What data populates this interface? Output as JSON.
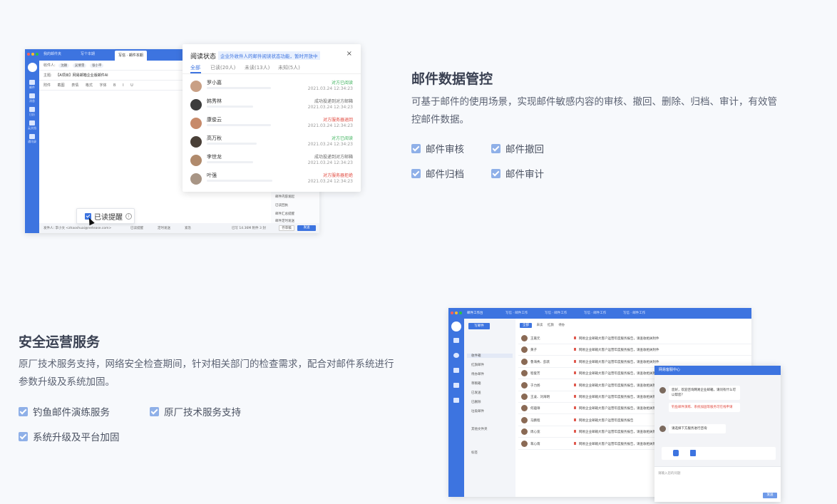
{
  "section1": {
    "title": "邮件数据管控",
    "description": "可基于邮件的使用场景，实现邮件敏感内容的审核、撤回、删除、归档、审计，有效管控邮件数据。",
    "checks": [
      "邮件审核",
      "邮件撤回",
      "邮件归档",
      "邮件审计"
    ]
  },
  "section2": {
    "title": "安全运营服务",
    "description": "原厂技术服务支持，网络安全检查期间，针对相关部门的检查需求，配合对邮件系统进行参数升级及系统加固。",
    "checks": [
      "钓鱼邮件演练服务",
      "原厂技术服务支持",
      "系统升级及平台加固"
    ]
  },
  "compose": {
    "tabs": [
      "我的邮件夹",
      "写个本期",
      "写信 · 邮件本期"
    ],
    "sidebar": [
      "邮件",
      "消息",
      "日历",
      "云文档",
      "通讯录"
    ],
    "recipient_label": "收件人:",
    "recipients": [
      "沈颖",
      "吴倩雪",
      "张小平"
    ],
    "subject_label": "主题:",
    "subject": "【A项目】网易邮箱企业版邮件AI",
    "toolbar": [
      "附件",
      "截图",
      "表情",
      "格式",
      "字体",
      "B",
      "I",
      "U"
    ],
    "right_panel": [
      "邮件内容发起",
      "已读回执",
      "邮件汇总提醒",
      "邮件定时发送"
    ],
    "bottom": {
      "sender": "发件人: 李小文 <zhaoshuai@netease.com>",
      "options": [
        "已读提醒",
        "定时发送",
        "紧急"
      ],
      "size": "已写 14.36M 附件 3 封",
      "save": "存草稿",
      "send": "发送"
    },
    "reminder_label": "已读提醒",
    "reminder_info": "i"
  },
  "read_status": {
    "title": "阅读状态",
    "notice": "企业外收件人的邮件阅读状态功能，暂时开放中",
    "close": "×",
    "tabs": [
      "全部",
      "已读(20人)",
      "未读(13人)",
      "未知(5人)"
    ],
    "rows": [
      {
        "name": "罗小嘉",
        "status": "对方已阅读",
        "status_color": "#3db35c",
        "time": "2021.03.24 12:34:23",
        "bar": 90
      },
      {
        "name": "韩秀林",
        "status": "成功投递到对方邮箱",
        "status_color": "#666666",
        "time": "2021.03.24 12:34:23",
        "bar": 65
      },
      {
        "name": "康俊云",
        "status": "对方服务器退回",
        "status_color": "#e0483e",
        "time": "2021.03.24 12:34:23",
        "bar": 90
      },
      {
        "name": "高万秋",
        "status": "对方已阅读",
        "status_color": "#3db35c",
        "time": "2021.03.24 12:34:23",
        "bar": 70
      },
      {
        "name": "李世龙",
        "status": "成功投递到对方邮箱",
        "status_color": "#666666",
        "time": "2021.03.24 12:34:23",
        "bar": 65
      },
      {
        "name": "叶强",
        "status": "对方服务器拒绝",
        "status_color": "#e0483e",
        "time": "2021.03.24 12:34:23",
        "bar": 92
      }
    ]
  },
  "mail_client": {
    "tabs": [
      "邮件工作台",
      "写信 · 邮件工作",
      "写信 · 邮件工作",
      "写信 · 邮件工作",
      "写信 · 邮件工作"
    ],
    "write_button": "写邮件",
    "nav": [
      "收件箱",
      "红旗邮件",
      "待办邮件",
      "草稿箱",
      "已发送",
      "已删除",
      "垃圾邮件",
      "其他文件夹",
      "标签"
    ],
    "filters": [
      "全部",
      "未读",
      "红旗",
      "待办"
    ],
    "rows": [
      {
        "name": "王嘉元",
        "subject": "网易企业邮箱大客户运营年度服务报告，请查收相关附件"
      },
      {
        "name": "黄子",
        "subject": "网易企业邮箱大客户运营年度服务报告，请查收相关附件"
      },
      {
        "name": "鲁海秀、彭跃",
        "subject": "网易企业邮箱大客户运营年度服务报告，请查收相关附件"
      },
      {
        "name": "程俊芳",
        "subject": "网易企业邮箱大客户运营年度服务报告，请查收相关附件"
      },
      {
        "name": "于力扬",
        "subject": "网易企业邮箱大客户运营年度服务报告，请查收相关附件"
      },
      {
        "name": "王凌、刘海明",
        "subject": "网易企业邮箱大客户运营年度服务报告，请查收相关附件"
      },
      {
        "name": "何蕴璋",
        "subject": "网易企业邮箱大客户运营年度服务报告，请查收相关附件"
      },
      {
        "name": "马鹏程",
        "subject": "网易企业邮箱大客户运营年度服务报告"
      },
      {
        "name": "周心宽",
        "subject": "网易企业邮箱大客户运营年度服务报告，请查收相关附件"
      },
      {
        "name": "蒋心雨",
        "subject": "网易企业邮箱大客户运营年度服务报告，请查收相关附件"
      }
    ]
  },
  "chat": {
    "title": "网易客服中心",
    "bubble1": "您好，欢迎咨询网易企业邮箱，请问有什么可以帮您？",
    "bubble2": "钓鱼邮件演练、系统加固等服务可在线申请",
    "bubble3": "请选择下方服务进行咨询",
    "placeholder": "请输入您的问题",
    "send": "发送"
  }
}
